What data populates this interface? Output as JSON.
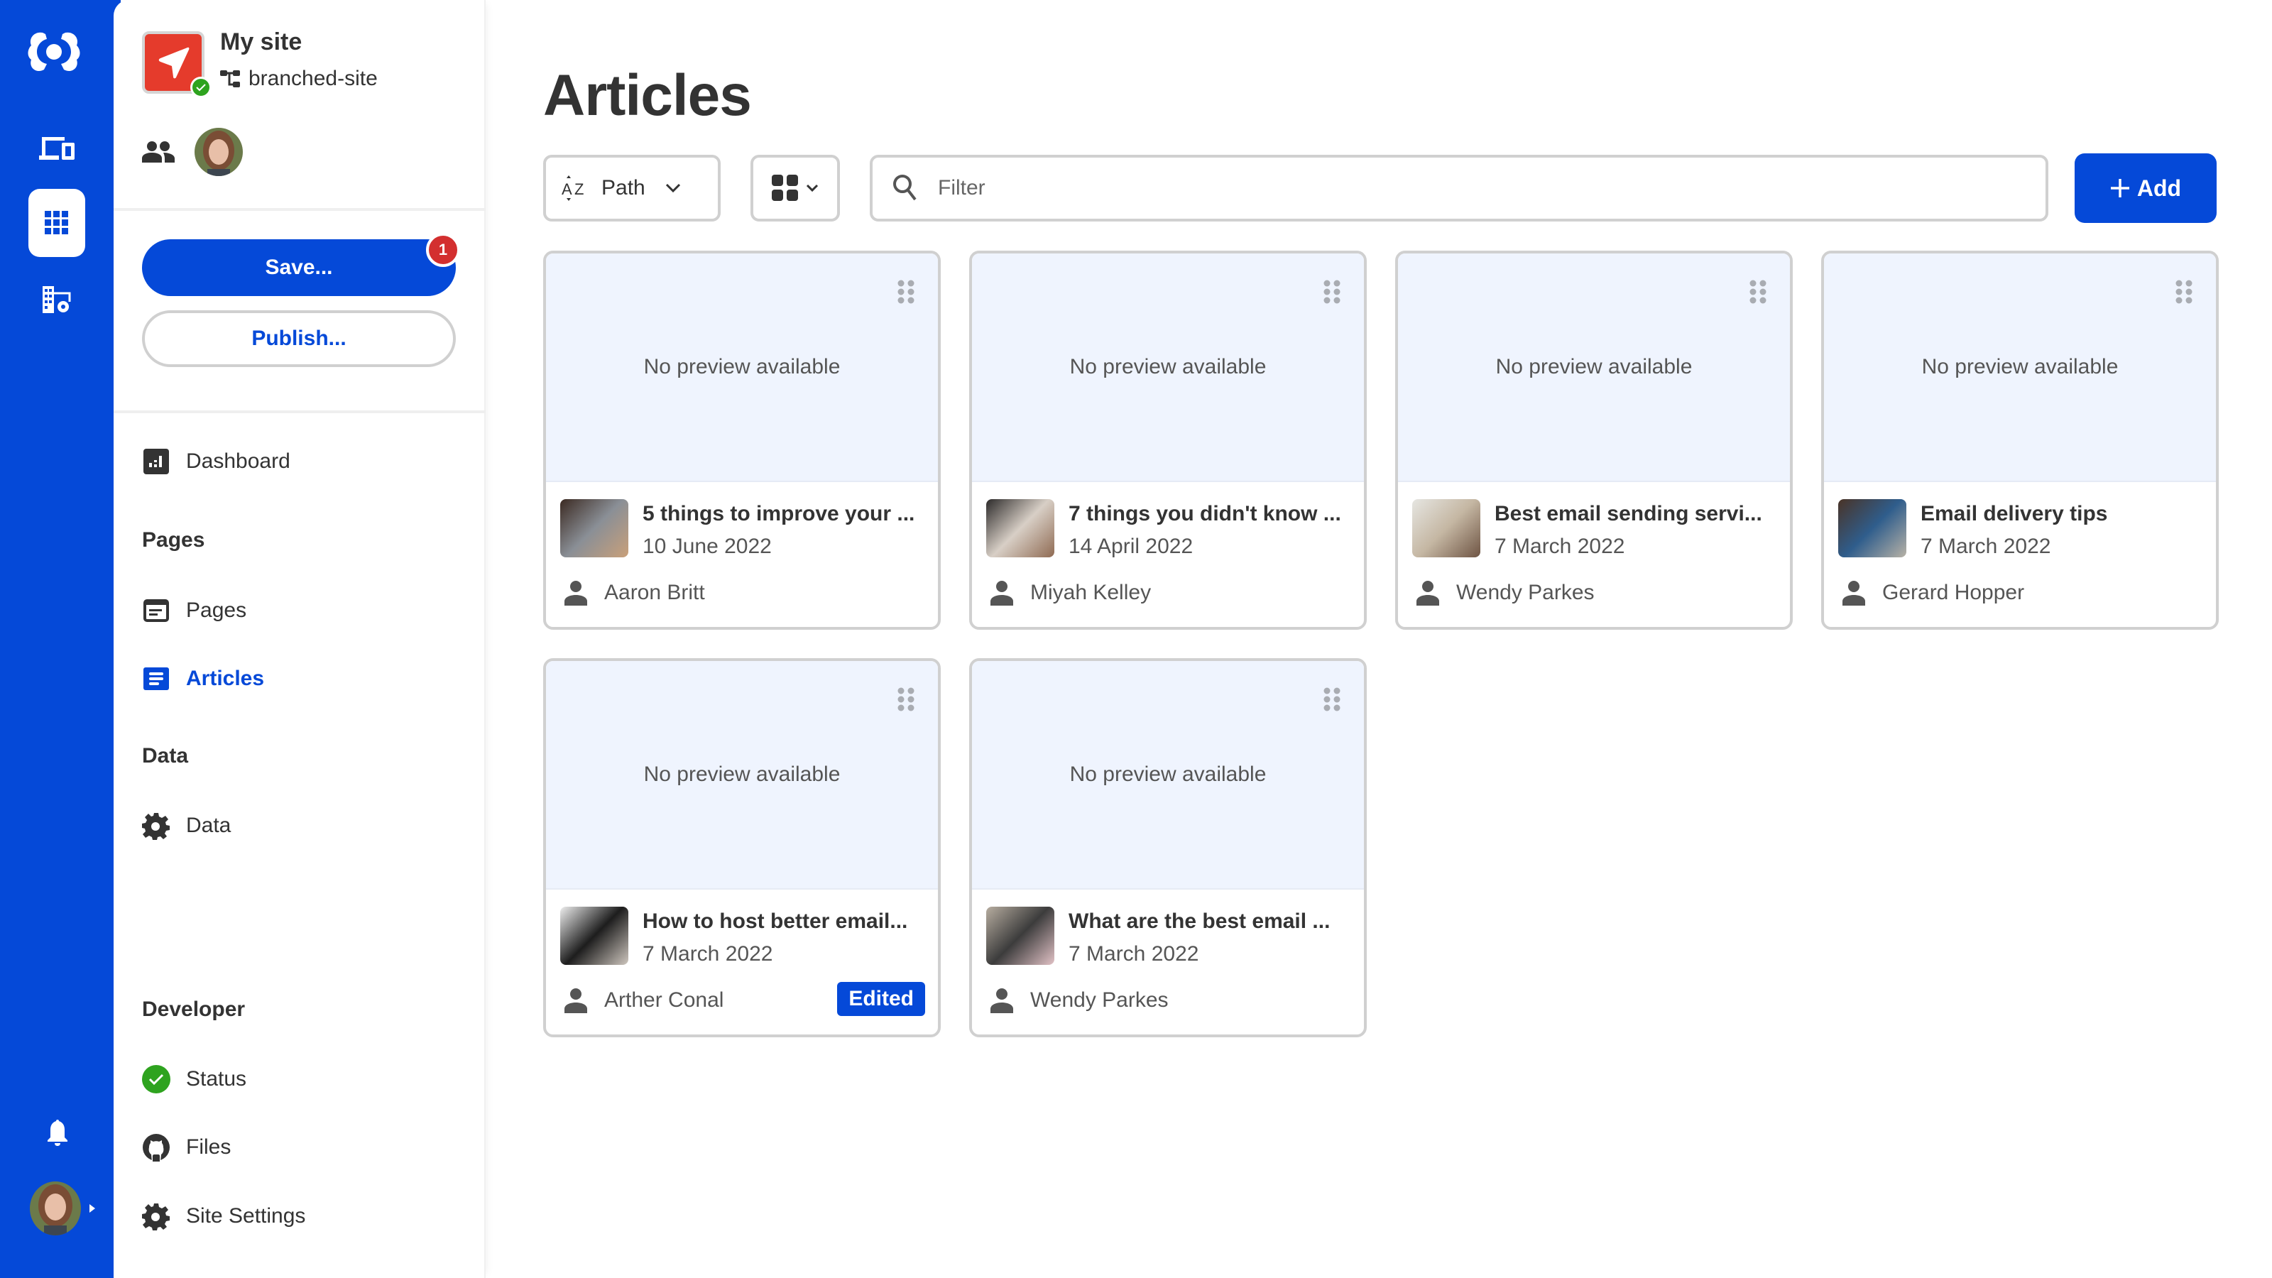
{
  "rail": {
    "brand_color": "#0549d8",
    "items": [
      {
        "icon": "logo-icon"
      },
      {
        "icon": "devices-icon"
      },
      {
        "icon": "apps-grid-icon",
        "active": true
      },
      {
        "icon": "building-settings-icon"
      },
      {
        "icon": "bell-icon"
      },
      {
        "icon": "user-avatar"
      }
    ]
  },
  "site": {
    "name": "My site",
    "branch": "branched-site",
    "status": "ok"
  },
  "actions": {
    "save_label": "Save...",
    "save_badge": "1",
    "publish_label": "Publish..."
  },
  "nav": {
    "dashboard": "Dashboard",
    "pages_heading": "Pages",
    "pages": "Pages",
    "articles": "Articles",
    "data_heading": "Data",
    "data": "Data",
    "developer_heading": "Developer",
    "status": "Status",
    "files": "Files",
    "site_settings": "Site Settings"
  },
  "main": {
    "title": "Articles",
    "sort_label": "Path",
    "filter_placeholder": "Filter",
    "filter_value": "",
    "add_label": "Add"
  },
  "cards": [
    {
      "preview": "No preview available",
      "title": "5 things to improve your ...",
      "date": "10 June 2022",
      "author": "Aaron Britt",
      "badge": ""
    },
    {
      "preview": "No preview available",
      "title": "7 things you didn't know ...",
      "date": "14 April 2022",
      "author": "Miyah Kelley",
      "badge": ""
    },
    {
      "preview": "No preview available",
      "title": "Best email sending servi...",
      "date": "7 March 2022",
      "author": "Wendy Parkes",
      "badge": ""
    },
    {
      "preview": "No preview available",
      "title": "Email delivery tips",
      "date": "7 March 2022",
      "author": "Gerard Hopper",
      "badge": ""
    },
    {
      "preview": "No preview available",
      "title": "How to host better email...",
      "date": "7 March 2022",
      "author": "Arther Conal",
      "badge": "Edited"
    },
    {
      "preview": "No preview available",
      "title": "What are the best email ...",
      "date": "7 March 2022",
      "author": "Wendy Parkes",
      "badge": ""
    }
  ]
}
